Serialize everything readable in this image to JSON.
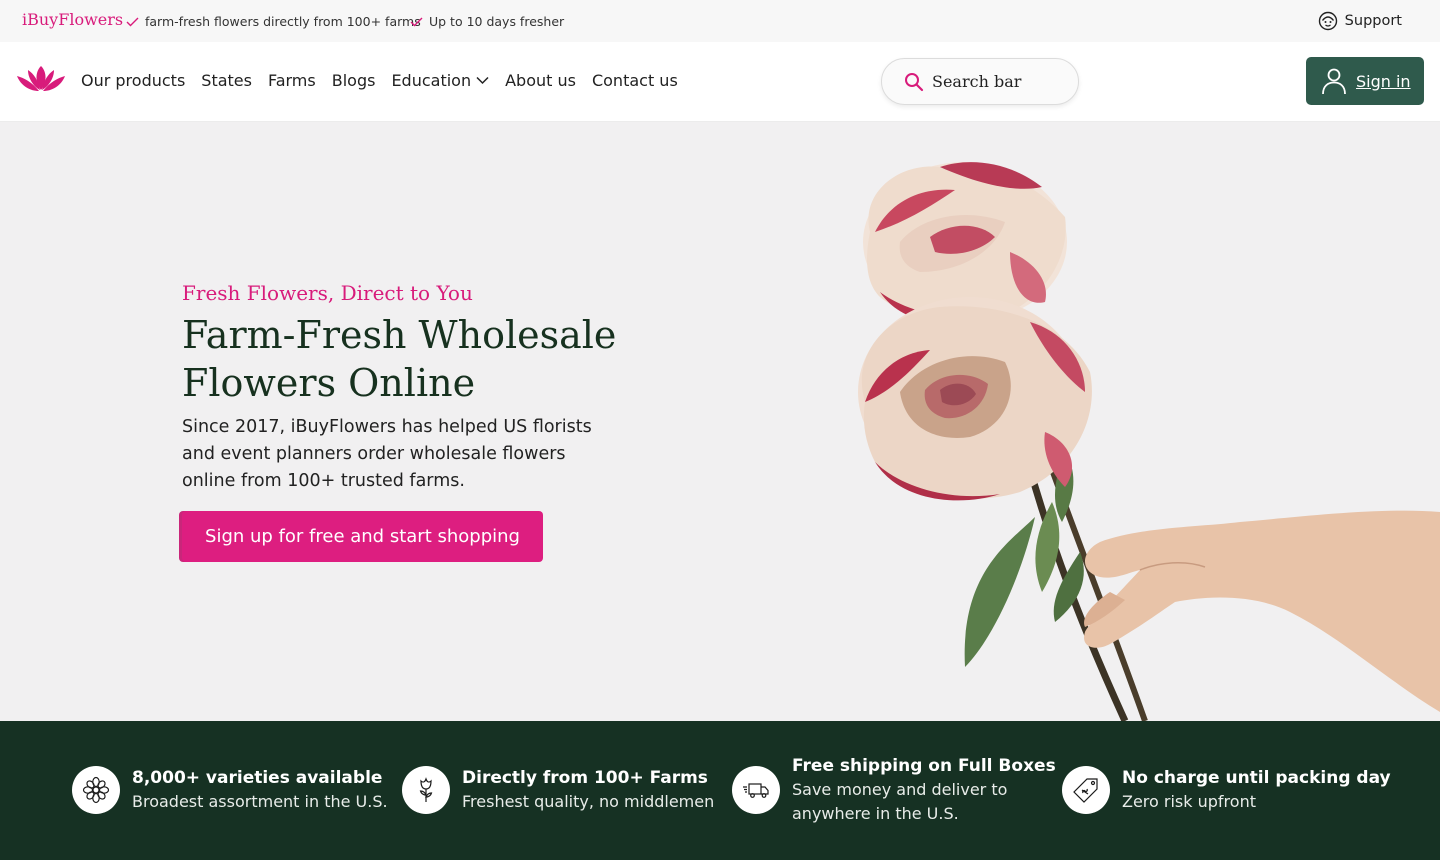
{
  "topbar": {
    "brand": "iBuyFlowers",
    "perks": [
      "farm-fresh flowers directly from 100+ farms",
      "Up to 10 days fresher"
    ],
    "support_label": "Support"
  },
  "nav": {
    "items": [
      "Our products",
      "States",
      "Farms",
      "Blogs",
      "Education",
      "About us",
      "Contact us"
    ],
    "search_label": "Search bar",
    "signin_label": "Sign in"
  },
  "hero": {
    "eyebrow": "Fresh Flowers, Direct to You",
    "title": "Farm-Fresh Wholesale Flowers Online",
    "description": "Since 2017, iBuyFlowers has helped US florists and event planners order wholesale flowers online from 100+ trusted farms.",
    "cta_label": "Sign up for free and start shopping"
  },
  "benefits": [
    {
      "icon": "flower-icon",
      "title": "8,000+ varieties available",
      "subtitle": "Broadest assortment in the U.S."
    },
    {
      "icon": "rose-icon",
      "title": "Directly from 100+ Farms",
      "subtitle": "Freshest quality, no middlemen"
    },
    {
      "icon": "truck-icon",
      "title": "Free shipping on Full Boxes",
      "subtitle": "Save money and deliver to anywhere in the U.S."
    },
    {
      "icon": "price-tag-icon",
      "title": "No charge until packing day",
      "subtitle": "Zero risk upfront"
    }
  ],
  "colors": {
    "brand_pink": "#d81b7b",
    "cta_pink": "#dd1e80",
    "dark_green": "#163123",
    "signin_green": "#2f5a4c",
    "hero_bg": "#f1f0f1"
  }
}
